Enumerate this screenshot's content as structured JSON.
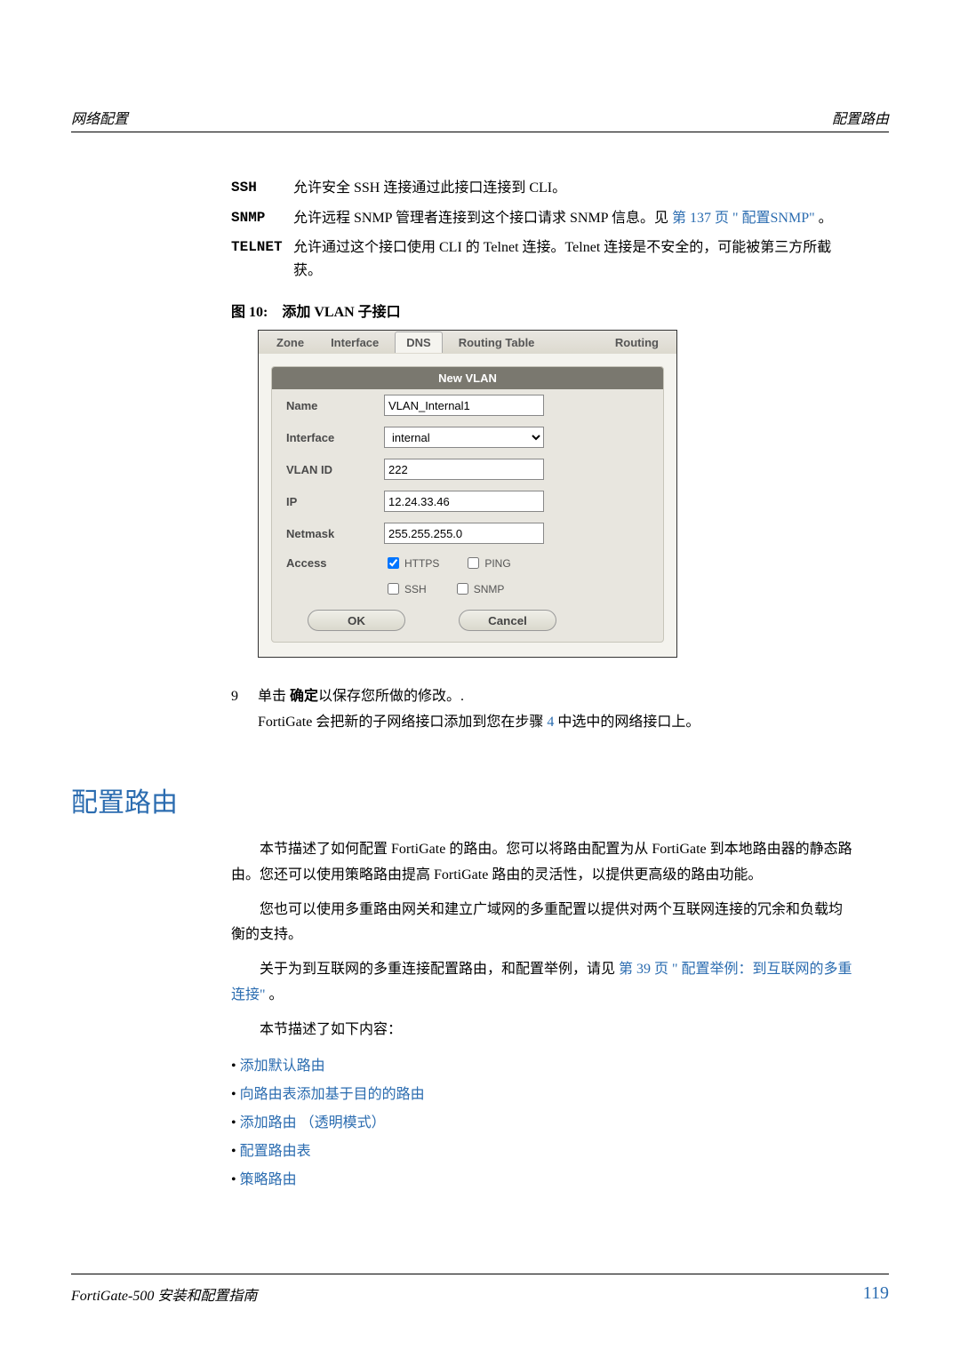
{
  "header": {
    "left": "网络配置",
    "right": "配置路由"
  },
  "defs": [
    {
      "term": "SSH",
      "desc": "允许安全 SSH 连接通过此接口连接到 CLI。"
    },
    {
      "term": "SNMP",
      "desc_prefix": "允许远程 SNMP 管理者连接到这个接口请求 SNMP 信息。见  ",
      "link": "第 137 页 \" 配置SNMP\"",
      "desc_suffix": " 。"
    },
    {
      "term": "TELNET",
      "desc": "允许通过这个接口使用 CLI 的 Telnet 连接。Telnet 连接是不安全的，可能被第三方所截获。"
    }
  ],
  "figure": {
    "label": "图 10:",
    "caption": "添加 VLAN 子接口"
  },
  "screenshot": {
    "tabs": [
      "Zone",
      "Interface",
      "DNS",
      "Routing Table",
      "Routing"
    ],
    "active_tab_index": 2,
    "panel_title": "New VLAN",
    "fields": {
      "name_label": "Name",
      "name_value": "VLAN_Internal1",
      "interface_label": "Interface",
      "interface_value": "internal",
      "vlanid_label": "VLAN ID",
      "vlanid_value": "222",
      "ip_label": "IP",
      "ip_value": "12.24.33.46",
      "netmask_label": "Netmask",
      "netmask_value": "255.255.255.0",
      "access_label": "Access",
      "access_options": [
        {
          "label": "HTTPS",
          "checked": true
        },
        {
          "label": "PING",
          "checked": false
        },
        {
          "label": "SSH",
          "checked": false
        },
        {
          "label": "SNMP",
          "checked": false
        }
      ]
    },
    "ok_label": "OK",
    "cancel_label": "Cancel"
  },
  "step": {
    "num": "9",
    "line1_prefix": "单击 ",
    "line1_bold": "确定",
    "line1_suffix": "以保存您所做的修改。.",
    "line2_prefix": "FortiGate 会把新的子网络接口添加到您在步骤 ",
    "line2_link": "4",
    "line2_suffix": " 中选中的网络接口上。"
  },
  "section_title": "配置路由",
  "paragraphs": {
    "p1": "本节描述了如何配置 FortiGate 的路由。您可以将路由配置为从 FortiGate 到本地路由器的静态路由。您还可以使用策略路由提高 FortiGate 路由的灵活性，以提供更高级的路由功能。",
    "p2": "您也可以使用多重路由网关和建立广域网的多重配置以提供对两个互联网连接的冗余和负载均衡的支持。",
    "p3_prefix": "关于为到互联网的多重连接配置路由，和配置举例，请见   ",
    "p3_link": "第 39 页 \" 配置举例：到互联网的多重连接\"",
    "p3_suffix": " 。",
    "p4": "本节描述了如下内容："
  },
  "bullets": [
    "添加默认路由",
    "向路由表添加基于目的的路由",
    "添加路由 （透明模式）",
    "配置路由表",
    "策略路由"
  ],
  "footer": {
    "left": "FortiGate-500 安装和配置指南",
    "page": "119"
  }
}
